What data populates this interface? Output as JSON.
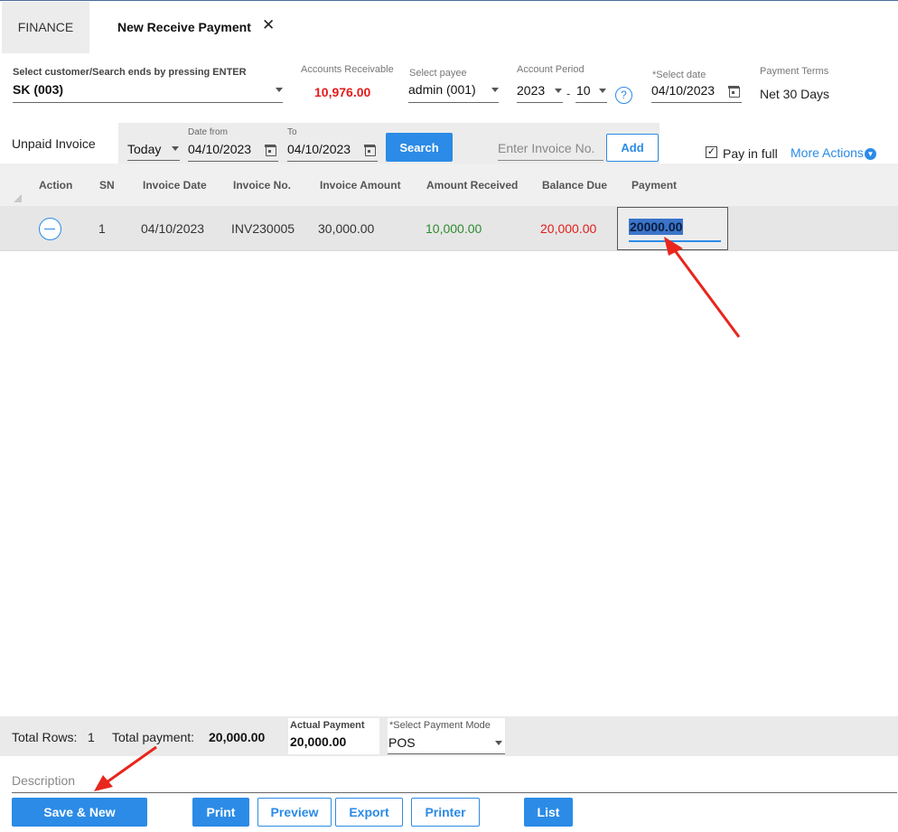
{
  "tabs": {
    "finance": "FINANCE",
    "active": "New Receive Payment",
    "close": "✕"
  },
  "header": {
    "customer_label": "Select customer/Search ends by pressing ENTER",
    "customer_value": "SK (003)",
    "ar_label": "Accounts Receivable",
    "ar_value": "10,976.00",
    "payee_label": "Select payee",
    "payee_value": "admin (001)",
    "period_label": "Account Period",
    "period_year": "2023",
    "period_sep": "-",
    "period_month": "10",
    "help": "?",
    "date_label": "*Select date",
    "date_value": "04/10/2023",
    "terms_label": "Payment Terms",
    "terms_value": "Net 30 Days"
  },
  "filter": {
    "unpaid_label": "Unpaid Invoice",
    "range": "Today",
    "from_label": "Date from",
    "from_value": "04/10/2023",
    "to_label": "To",
    "to_value": "04/10/2023",
    "search_button": "Search",
    "invoice_placeholder": "Enter Invoice No.",
    "add_button": "Add",
    "pay_in_full_checked": true,
    "pay_in_full_label": "Pay in full",
    "more_actions": "More Actions"
  },
  "table": {
    "columns": [
      "Action",
      "SN",
      "Invoice Date",
      "Invoice No.",
      "Invoice Amount",
      "Amount Received",
      "Balance Due",
      "Payment"
    ],
    "rows": [
      {
        "sn": "1",
        "invoice_date": "04/10/2023",
        "invoice_no": "INV230005",
        "invoice_amount": "30,000.00",
        "amount_received": "10,000.00",
        "balance_due": "20,000.00",
        "payment": "20000.00"
      }
    ]
  },
  "footer": {
    "total_rows_label": "Total Rows:",
    "total_rows_value": "1",
    "total_payment_label": "Total payment:",
    "total_payment_value": "20,000.00",
    "actual_payment_label": "Actual Payment",
    "actual_payment_value": "20,000.00",
    "payment_mode_label": "*Select Payment Mode",
    "payment_mode_value": "POS",
    "description_placeholder": "Description"
  },
  "buttons": {
    "save_new": "Save & New",
    "print": "Print",
    "preview": "Preview",
    "export": "Export",
    "printer": "Printer",
    "list": "List"
  },
  "colors": {
    "accent": "#2b8be6",
    "negative": "#e31b1b",
    "positive": "#2e8b2e",
    "annotation_arrow": "#e8261c"
  }
}
